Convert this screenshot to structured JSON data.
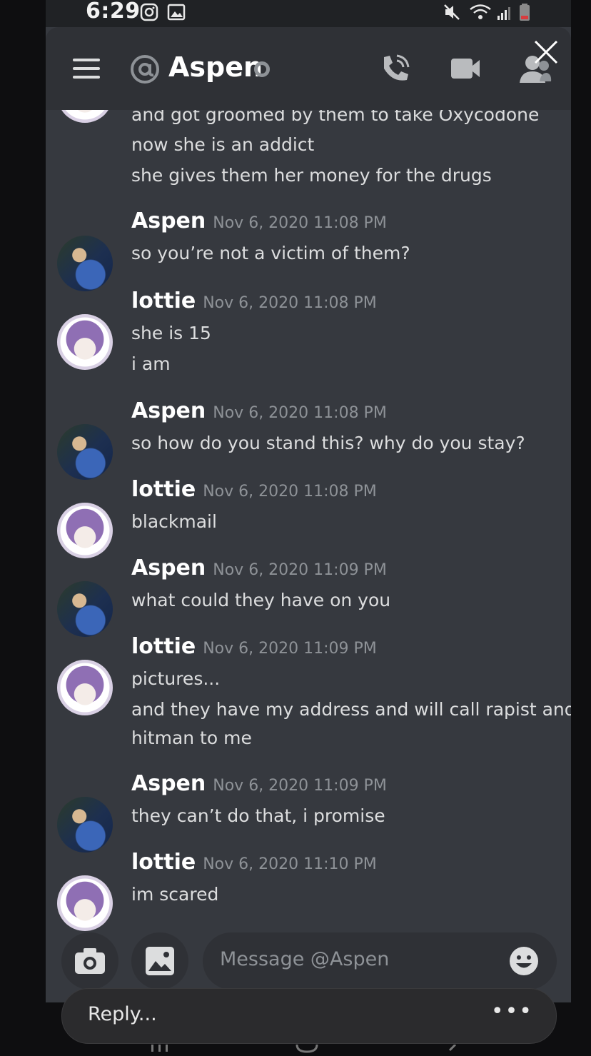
{
  "status_bar": {
    "time": "6:29"
  },
  "header": {
    "channel_name": "Aspen",
    "icons": [
      "menu-icon",
      "at-icon",
      "call-icon",
      "video-icon",
      "member-icon",
      "close-icon"
    ]
  },
  "messages": {
    "partial": {
      "lines": [
        "and got groomed by them to take Oxycodone",
        "now she is an addict",
        "she gives them her money for the drugs"
      ]
    },
    "m1": {
      "author": "Aspen",
      "timestamp": "Nov 6, 2020 11:08 PM",
      "lines": [
        "so you’re not a victim of them?"
      ]
    },
    "m2": {
      "author": "lottie",
      "timestamp": "Nov 6, 2020 11:08 PM",
      "lines": [
        "she is 15",
        "i am"
      ]
    },
    "m3": {
      "author": "Aspen",
      "timestamp": "Nov 6, 2020 11:08 PM",
      "lines": [
        "so how do you stand this? why do you stay?"
      ]
    },
    "m4": {
      "author": "lottie",
      "timestamp": "Nov 6, 2020 11:08 PM",
      "lines": [
        "blackmail"
      ]
    },
    "m5": {
      "author": "Aspen",
      "timestamp": "Nov 6, 2020 11:09 PM",
      "lines": [
        "what could they have on you"
      ]
    },
    "m6": {
      "author": "lottie",
      "timestamp": "Nov 6, 2020 11:09 PM",
      "lines": [
        "pictures...",
        "and they have my address and will call rapist and",
        "hitman to me"
      ]
    },
    "m7": {
      "author": "Aspen",
      "timestamp": "Nov 6, 2020 11:09 PM",
      "lines": [
        "they can’t do that, i promise"
      ]
    },
    "m8": {
      "author": "lottie",
      "timestamp": "Nov 6, 2020 11:10 PM",
      "lines": [
        "im scared"
      ]
    }
  },
  "composer": {
    "placeholder": "Message @Aspen"
  },
  "reply_bar": {
    "label": "Reply...",
    "more": "•••"
  },
  "colors": {
    "background": "#36393f",
    "header": "#2f3136",
    "text": "#dcddde",
    "muted": "#8e9297"
  }
}
